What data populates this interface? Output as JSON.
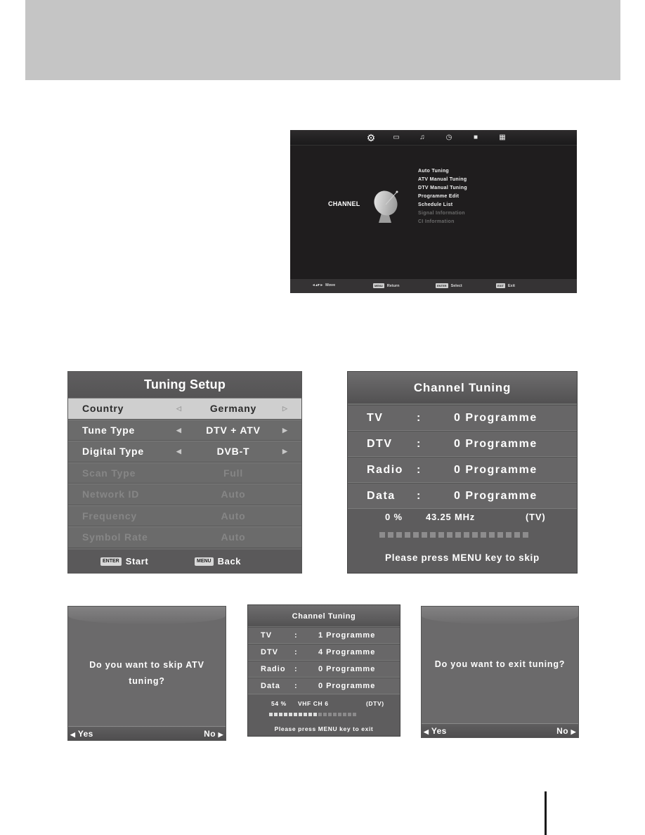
{
  "main_menu": {
    "top_icons": [
      "gear-icon",
      "monitor-icon",
      "music-note-icon",
      "clock-icon",
      "lock-icon",
      "grid-icon"
    ],
    "section_label": "CHANNEL",
    "items": [
      {
        "label": "Auto Tuning",
        "enabled": true
      },
      {
        "label": "ATV Manual Tuning",
        "enabled": true
      },
      {
        "label": "DTV Manual Tuning",
        "enabled": true
      },
      {
        "label": "Programme Edit",
        "enabled": true
      },
      {
        "label": "Schedule List",
        "enabled": true
      },
      {
        "label": "Signal Information",
        "enabled": false
      },
      {
        "label": "CI Information",
        "enabled": false
      }
    ],
    "hints": [
      {
        "key": "◂ ▴▾ ▸",
        "label": "Move"
      },
      {
        "key": "MENU",
        "label": "Return"
      },
      {
        "key": "ENTER",
        "label": "Select"
      },
      {
        "key": "EXIT",
        "label": "Exit"
      }
    ]
  },
  "tuning_setup": {
    "title": "Tuning Setup",
    "rows": [
      {
        "label": "Country",
        "value": "Germany",
        "selected": true,
        "enabled": true
      },
      {
        "label": "Tune Type",
        "value": "DTV + ATV",
        "selected": false,
        "enabled": true
      },
      {
        "label": "Digital Type",
        "value": "DVB-T",
        "selected": false,
        "enabled": true
      },
      {
        "label": "Scan Type",
        "value": "Full",
        "selected": false,
        "enabled": false
      },
      {
        "label": "Network ID",
        "value": "Auto",
        "selected": false,
        "enabled": false
      },
      {
        "label": "Frequency",
        "value": "Auto",
        "selected": false,
        "enabled": false
      },
      {
        "label": "Symbol Rate",
        "value": "Auto",
        "selected": false,
        "enabled": false
      }
    ],
    "footer": [
      {
        "key": "ENTER",
        "label": "Start"
      },
      {
        "key": "MENU",
        "label": "Back"
      }
    ],
    "arrow_left": "◀",
    "arrow_right": "▶"
  },
  "channel_tuning": {
    "title": "Channel Tuning",
    "rows": [
      {
        "label": "TV",
        "sep": ":",
        "count": "0 Programme"
      },
      {
        "label": "DTV",
        "sep": ":",
        "count": "0 Programme"
      },
      {
        "label": "Radio",
        "sep": ":",
        "count": "0 Programme"
      },
      {
        "label": "Data",
        "sep": ":",
        "count": "0 Programme"
      }
    ],
    "percent": "0  %",
    "frequency": "43.25 MHz",
    "mode": "(TV)",
    "progress_fraction": 0,
    "progress_segments": 18,
    "message": "Please press MENU key to skip"
  },
  "skip_dialog": {
    "question_line1": "Do you want to skip ATV",
    "question_line2": "tuning?",
    "yes": "Yes",
    "no": "No"
  },
  "channel_tuning_progress": {
    "title": "Channel Tuning",
    "rows": [
      {
        "label": "TV",
        "sep": ":",
        "count": "1 Programme"
      },
      {
        "label": "DTV",
        "sep": ":",
        "count": "4 Programme"
      },
      {
        "label": "Radio",
        "sep": ":",
        "count": "0 Programme"
      },
      {
        "label": "Data",
        "sep": ":",
        "count": "0 Programme"
      }
    ],
    "percent": "54 %",
    "band": "VHF  CH  6",
    "mode": "(DTV)",
    "progress_fraction": 0.54,
    "progress_segments": 18,
    "message": "Please press MENU key to exit"
  },
  "exit_dialog": {
    "question": "Do you want to exit tuning?",
    "yes": "Yes",
    "no": "No"
  }
}
